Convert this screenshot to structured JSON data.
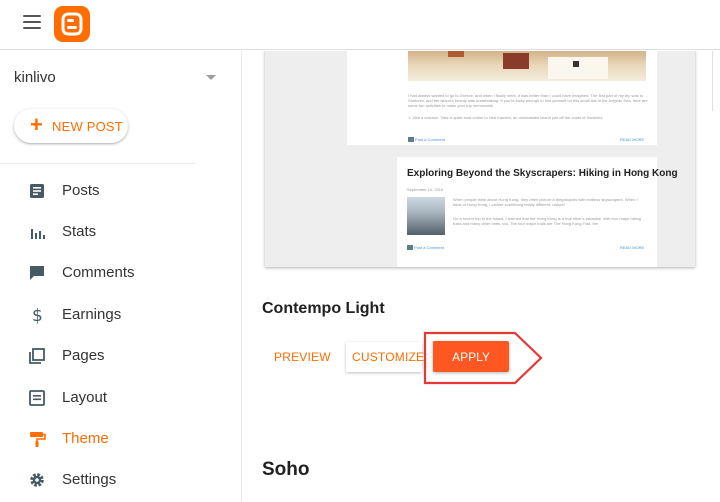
{
  "header": {
    "menu_icon": "hamburger-menu-icon",
    "logo": "blogger-logo",
    "brand_color": "#ff6d00"
  },
  "sidebar": {
    "blog_name": "kinlivo",
    "new_post_label": "NEW POST",
    "items": [
      {
        "label": "Posts",
        "icon": "posts-icon",
        "active": false
      },
      {
        "label": "Stats",
        "icon": "stats-icon",
        "active": false
      },
      {
        "label": "Comments",
        "icon": "comments-icon",
        "active": false
      },
      {
        "label": "Earnings",
        "icon": "dollar-icon",
        "active": false
      },
      {
        "label": "Pages",
        "icon": "pages-icon",
        "active": false
      },
      {
        "label": "Layout",
        "icon": "layout-icon",
        "active": false
      },
      {
        "label": "Theme",
        "icon": "theme-paint-roller-icon",
        "active": true
      },
      {
        "label": "Settings",
        "icon": "gear-icon",
        "active": false
      }
    ]
  },
  "preview": {
    "post1_text1": "I had always wanted to go to Greece, and when I finally went, it was better than I could have imagined. The first part of my trip was to Santorini, and the island's beauty was breathtaking. If you're lucky enough to find yourself on this small isle in the Aegean Sea, here are some fun activities to make your trip memorable.",
    "post1_text2": "1. Visit a volcano. Take a quick boat cruise to Nea Kameni, an uninhabited island just off the coast of Santorini.",
    "post1_comment": "Post a Comment",
    "post1_read_more": "READ MORE",
    "post2_title": "Exploring Beyond the Skyscrapers: Hiking in Hong Kong",
    "post2_date": "September 10, 2016",
    "post2_text1": "When people think about Hong Kong, they often picture a megalopolis with endless skyscrapers. When I think of Hong Kong, I picture something totally different: nature!",
    "post2_text2": "On a recent trip to the island, I learned that the Hong Kong is a true hiker's paradise, with four major hiking trails and many other ones, too. The four major trails are The Hong Kong Trail, the",
    "post2_comment": "Post a Comment",
    "post2_read_more": "READ MORE"
  },
  "themes": [
    {
      "name": "Contempo Light",
      "preview_label": "PREVIEW",
      "customize_label": "CUSTOMIZE",
      "apply_label": "APPLY"
    },
    {
      "name": "Soho"
    }
  ],
  "colors": {
    "accent": "#ff6d00",
    "apply_button": "#ff5722",
    "highlight_outline": "#e53935"
  }
}
